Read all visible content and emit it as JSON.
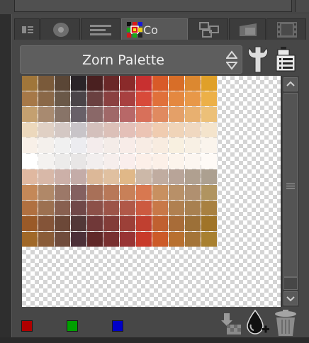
{
  "tabs": {
    "active_label": "Colc",
    "items": [
      "layer-property",
      "tool-settings",
      "navigator",
      "color-set",
      "layer",
      "material",
      "timeline"
    ]
  },
  "palette": {
    "name": "Zorn Palette"
  },
  "chips": [
    {
      "name": "red-chip",
      "color": "#b00000"
    },
    {
      "name": "green-chip",
      "color": "#00a000"
    },
    {
      "name": "blue-chip",
      "color": "#0000c8"
    }
  ],
  "swatches": [
    [
      "#a0763a",
      "#7a5a3a",
      "#5a4636",
      "#2a2428",
      "#4a2020",
      "#6a2828",
      "#8a2a2a",
      "#c83030",
      "#d85a28",
      "#d86e28",
      "#dc8830",
      "#e0a028"
    ],
    [
      "#a67848",
      "#8a6848",
      "#6a5848",
      "#4a4448",
      "#6a4040",
      "#8a4040",
      "#a84040",
      "#d84a3a",
      "#e0703a",
      "#e48840",
      "#e89848",
      "#ecb048"
    ],
    [
      "#c4a070",
      "#a88a70",
      "#887468",
      "#686068",
      "#8a6868",
      "#a06868",
      "#b86868",
      "#d8705a",
      "#e08a60",
      "#e4a068",
      "#e8b070",
      "#ecc078"
    ],
    [
      "#ecd8bc",
      "#e0d0c4",
      "#d4c8c4",
      "#c8c4c8",
      "#d4c0bc",
      "#dcc0b8",
      "#e4c0b8",
      "#ecc4b4",
      "#f0ccb0",
      "#f0d4b8",
      "#f0d8c0",
      "#f4e4cc"
    ],
    [
      "#f8f0e8",
      "#f4f0ec",
      "#f0f0f0",
      "#ececf0",
      "#f4ecec",
      "#f4ece8",
      "#f8ece8",
      "#f8ece4",
      "#f8ece0",
      "#f8f0e0",
      "#f8f0e4",
      "#faf4ec"
    ],
    [
      "#ffffff",
      "#f4f2f0",
      "#ecebea",
      "#e8e6e6",
      "#f2eeee",
      "#f6eeec",
      "#faeeec",
      "#fcefe8",
      "#fcf0e8",
      "#fcf4ec",
      "#fcf6f0",
      "#fefaf6"
    ],
    [
      "#e0b8a0",
      "#d8b8a8",
      "#ccb0a8",
      "#c4aca8",
      "#dcb898",
      "#e0c0a0",
      "#e0b888",
      "#ccb8a8",
      "#c0aca0",
      "#b8a498",
      "#b0a090",
      "#aca090"
    ],
    [
      "#c48858",
      "#b08868",
      "#9c7868",
      "#846060",
      "#a87058",
      "#b87858",
      "#c88058",
      "#d87850",
      "#c89060",
      "#b89068",
      "#b09070",
      "#b09460"
    ],
    [
      "#b07040",
      "#9c7050",
      "#886050",
      "#704848",
      "#8c5048",
      "#9c5448",
      "#b05848",
      "#cc5a40",
      "#c87848",
      "#b08050",
      "#a88050",
      "#a88040"
    ],
    [
      "#9a5a28",
      "#845438",
      "#6c4838",
      "#523838",
      "#703838",
      "#823c38",
      "#9c4038",
      "#c04030",
      "#c06030",
      "#a86c38",
      "#9c7038",
      "#a07428"
    ],
    [
      "#a06828",
      "#8a5c38",
      "#704c3c",
      "#4c3038",
      "#602828",
      "#783030",
      "#983434",
      "#c83a2a",
      "#cc5a28",
      "#b87030",
      "#a47438",
      "#a88030"
    ]
  ]
}
